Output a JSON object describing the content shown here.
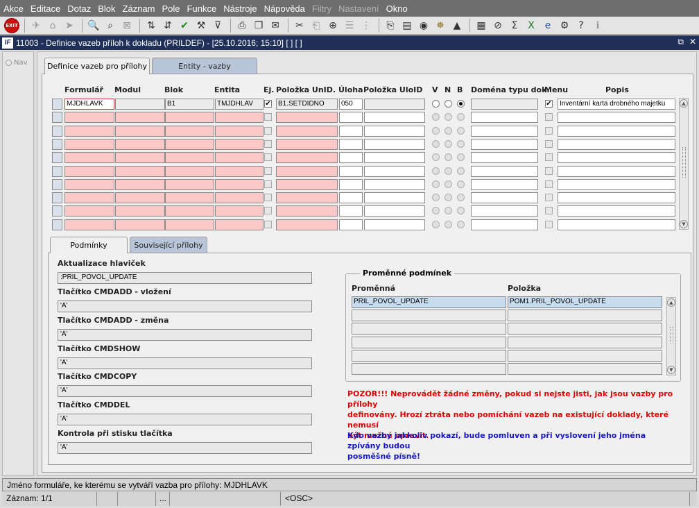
{
  "menu": [
    "Akce",
    "Editace",
    "Dotaz",
    "Blok",
    "Záznam",
    "Pole",
    "Funkce",
    "Nástroje",
    "Nápověda",
    "Filtry",
    "Nastavení",
    "Okno"
  ],
  "menu_disabled": [
    "Filtry",
    "Nastavení"
  ],
  "toolbar": {
    "exit_label": "EXIT"
  },
  "window": {
    "title": "11003 - Definice vazeb příloh k dokladu (PRILDEF) - [25.10.2016; 15:10]  [ ]  [ ]",
    "logo": "IF"
  },
  "nav": {
    "label": "Nav"
  },
  "tabs_top": {
    "active": "Definice vazeb pro přílohy",
    "inactive": "Entity - vazby"
  },
  "grid": {
    "headers": {
      "formular": "Formulář",
      "modul": "Modul",
      "blok": "Blok",
      "entita": "Entita",
      "ej": "Ej.",
      "polozka_unid": "Položka UnID.",
      "uloha": "Úloha",
      "polozka_uloid": "Položka UloID",
      "v": "V",
      "n": "N",
      "b": "B",
      "domena": "Doména typu dok.",
      "menu": "Menu",
      "popis": "Popis"
    },
    "first_row": {
      "formular": "MJDHLAVK",
      "modul": "",
      "blok": "B1",
      "entita": "TMJDHLAV",
      "ej_checked": true,
      "polozka_unid": "B1.SETDIDNO",
      "uloha": "050",
      "polozka_uloid": "",
      "radio": "B",
      "domena": "",
      "menu_checked": true,
      "popis": "Inventární karta drobného majetku"
    },
    "empty_rows": 9
  },
  "tabs_bottom": {
    "active": "Podmínky",
    "inactive": "Související přílohy"
  },
  "conditions": {
    "section_title": "Aktualizace hlaviček",
    "section_value": ":PRIL_POVOL_UPDATE",
    "fields": [
      {
        "label": "Tlačítko CMDADD - vložení",
        "value": "'A'"
      },
      {
        "label": "Tlačítko CMDADD - změna",
        "value": "'A'"
      },
      {
        "label": "Tlačítko CMDSHOW",
        "value": "'A'"
      },
      {
        "label": "Tlačítko CMDCOPY",
        "value": "'A'"
      },
      {
        "label": "Tlačítko CMDDEL",
        "value": "'A'"
      },
      {
        "label": "Kontrola při stisku tlačítka",
        "value": "'A'"
      }
    ]
  },
  "variables": {
    "title": "Proměnné podmínek",
    "col_var": "Proměnná",
    "col_item": "Položka",
    "rows": [
      {
        "var": "PRIL_POVOL_UPDATE",
        "item": "POM1.PRIL_POVOL_UPDATE"
      },
      {
        "var": "",
        "item": ""
      },
      {
        "var": "",
        "item": ""
      },
      {
        "var": "",
        "item": ""
      },
      {
        "var": "",
        "item": ""
      },
      {
        "var": "",
        "item": ""
      }
    ]
  },
  "warnings": {
    "red": "POZOR!!! Neprovádět žádné změny, pokud si nejste jisti, jak jsou vazby pro přílohy definovány. Hrozí ztráta nebo pomíchání vazeb na existující doklady, které nemusí být možné opravit.",
    "red_lines": [
      "POZOR!!! Neprovádět žádné změny, pokud si nejste jisti, jak jsou vazby pro přílohy",
      "definovány. Hrozí ztráta nebo pomíchání vazeb na existující doklady, které nemusí",
      "být možné opravit."
    ],
    "blue_lines": [
      "Kdo vazby jakkoliv pokazí, bude pomluven a při vyslovení jeho jména zpívány budou",
      "posměšné písně!"
    ],
    "red_color": "#e00000",
    "blue_color": "#1818c0"
  },
  "status": {
    "hint": "Jméno formuláře, ke kterému se vytváří vazba pro přílohy: MJDHLAVK",
    "record": "Záznam: 1/1",
    "dots": "...",
    "osc": "<OSC>"
  }
}
